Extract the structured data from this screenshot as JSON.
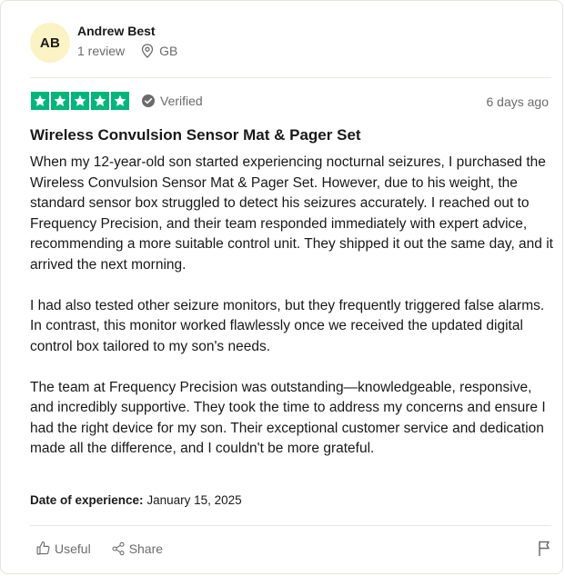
{
  "reviewer": {
    "initials": "AB",
    "name": "Andrew Best",
    "review_count": "1 review",
    "location": "GB",
    "avatar_color": "#fbf3c4"
  },
  "review": {
    "rating": 5,
    "rating_color": "#00b67a",
    "verified_label": "Verified",
    "date": "6 days ago",
    "title": "Wireless Convulsion Sensor Mat & Pager Set",
    "paragraphs": [
      "When my 12-year-old son started experiencing nocturnal seizures, I purchased the Wireless Convulsion Sensor Mat & Pager Set. However, due to his weight, the standard sensor box struggled to detect his seizures accurately. I reached out to Frequency Precision, and their team responded immediately with expert advice, recommending a more suitable control unit. They shipped it out the same day, and it arrived the next morning.",
      "I had also tested other seizure monitors, but they frequently triggered false alarms. In contrast, this monitor worked flawlessly once we received the updated digital control box tailored to my son's needs.",
      "The team at Frequency Precision was outstanding—knowledgeable, responsive, and incredibly supportive. They took the time to address my concerns and ensure I had the right device for my son. Their exceptional customer service and dedication made all the difference, and I couldn't be more grateful."
    ],
    "experience_label": "Date of experience:",
    "experience_date": "January 15, 2025"
  },
  "actions": {
    "useful_label": "Useful",
    "share_label": "Share"
  },
  "icons": {
    "location": "location-pin-icon",
    "verified": "check-circle-icon",
    "star": "star-icon",
    "useful": "thumbs-up-icon",
    "share": "share-icon",
    "report": "flag-icon"
  }
}
